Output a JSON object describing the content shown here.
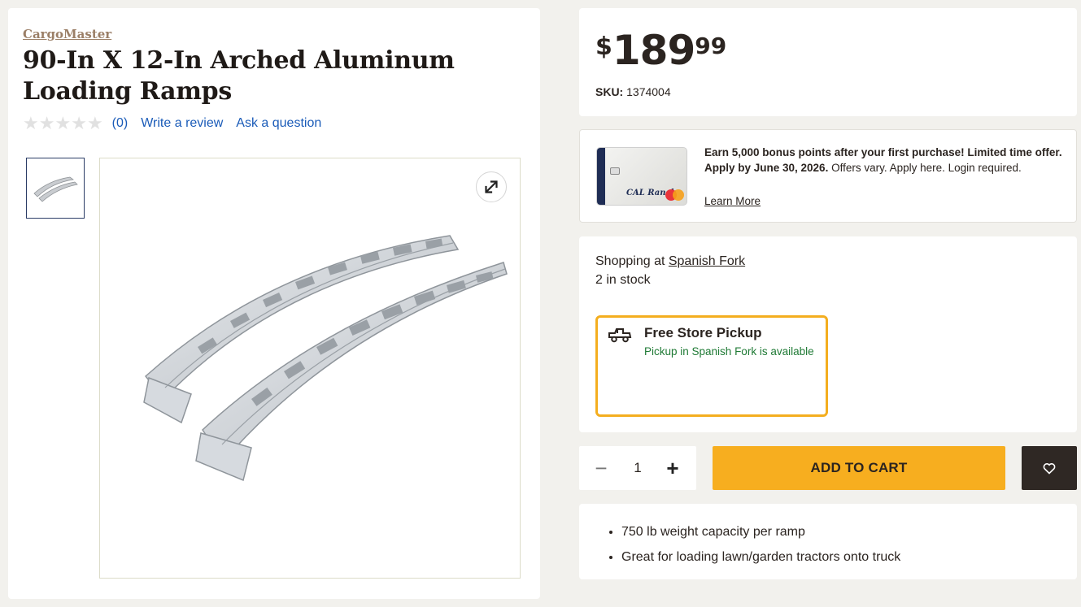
{
  "product": {
    "brand": "CargoMaster",
    "title": "90-In X 12-In Arched Aluminum Loading Ramps",
    "rating_stars": 0,
    "review_count": "(0)",
    "write_review": "Write a review",
    "ask_question": "Ask a question"
  },
  "gallery": {
    "thumbnail_icon": "ramp-thumbnail",
    "main_image_icon": "aluminum-ramps-image",
    "expand_icon": "expand-icon"
  },
  "pricing": {
    "currency": "$",
    "dollars": "189",
    "cents": "99",
    "sku_label": "SKU:",
    "sku_value": "1374004"
  },
  "promo": {
    "card_logo": "CAL Ranch",
    "bold_text": "Earn 5,000 bonus points after your first purchase! Limited time offer. Apply by June 30, 2026.",
    "normal_text": " Offers vary. Apply here. Login required.",
    "learn_more": "Learn More"
  },
  "store": {
    "shopping_at_label": "Shopping at ",
    "store_name": "Spanish Fork",
    "stock_text": "2 in stock",
    "pickup_title": "Free Store Pickup",
    "pickup_subtitle": "Pickup in Spanish Fork is available"
  },
  "cart": {
    "quantity": "1",
    "minus_label": "−",
    "plus_label": "+",
    "add_to_cart": "ADD TO CART"
  },
  "features": [
    "750 lb weight capacity per ramp",
    "Great for loading lawn/garden tractors onto truck"
  ],
  "colors": {
    "accent": "#f7ae1f",
    "brand_text": "#9b7f67",
    "link": "#1a5bb8",
    "available": "#1f7a35",
    "dark_button": "#2f2824"
  }
}
